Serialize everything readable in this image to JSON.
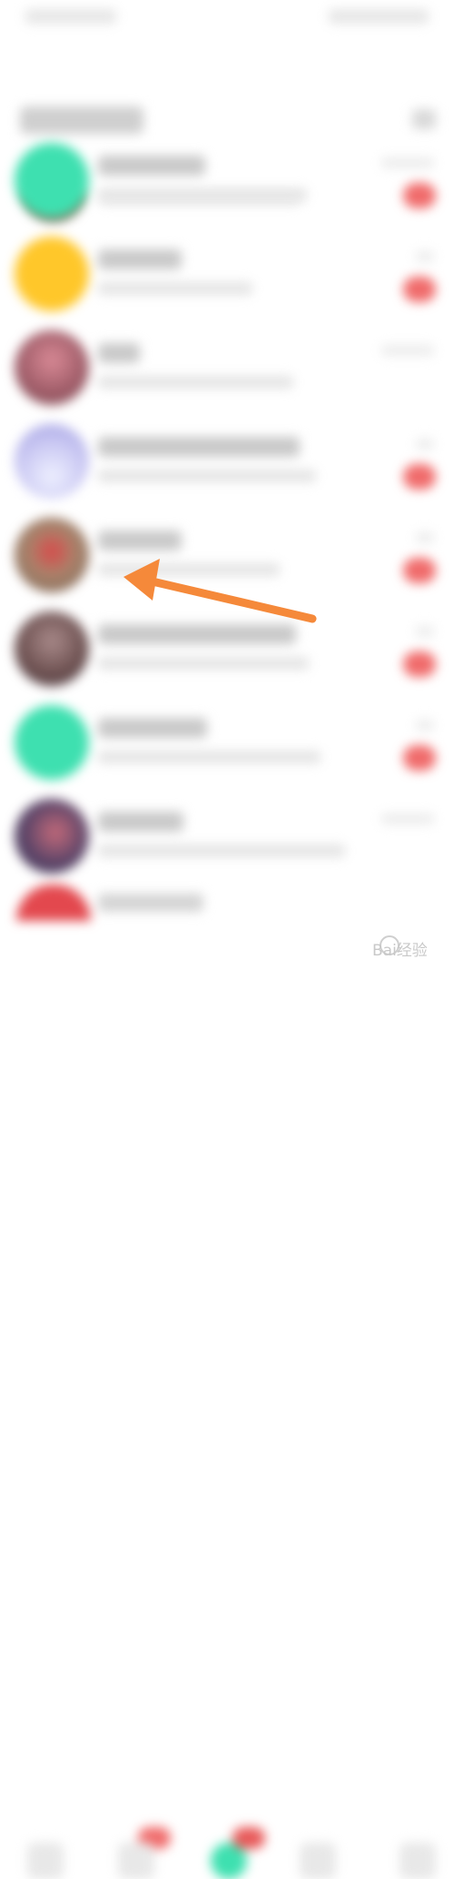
{
  "status_bar": {
    "time_text": "",
    "icons_text": ""
  },
  "header": {
    "title": "",
    "action_icon": "more-icon"
  },
  "chats": [
    {
      "avatar_color": "#3ee0b0",
      "name": "",
      "preview": "",
      "time": "",
      "badge": ""
    },
    {
      "avatar_color": "#ffc72a",
      "name": "",
      "preview": "",
      "time": "",
      "badge": ""
    },
    {
      "avatar_color": "#9c5a66",
      "name": "",
      "preview": "",
      "time": "",
      "badge": ""
    },
    {
      "avatar_color": "#c8c6f2",
      "name": "",
      "preview": "",
      "time": "",
      "badge": ""
    },
    {
      "avatar_color": "#a9846c",
      "name": "",
      "preview": "",
      "time": "",
      "badge": ""
    },
    {
      "avatar_color": "#6a4e4e",
      "name": "",
      "preview": "",
      "time": "",
      "badge": ""
    },
    {
      "avatar_color": "#3ee0b0",
      "name": "",
      "preview": "",
      "time": "",
      "badge": ""
    },
    {
      "avatar_color": "#5a4468",
      "name": "",
      "preview": "",
      "time": "",
      "badge": ""
    }
  ],
  "tab_bar": {
    "tabs": [
      "",
      "",
      "",
      "",
      ""
    ]
  },
  "annotation": {
    "arrow_color": "#f5893a",
    "target": "chat-item-5"
  },
  "watermark": {
    "text": "Bai经验"
  }
}
